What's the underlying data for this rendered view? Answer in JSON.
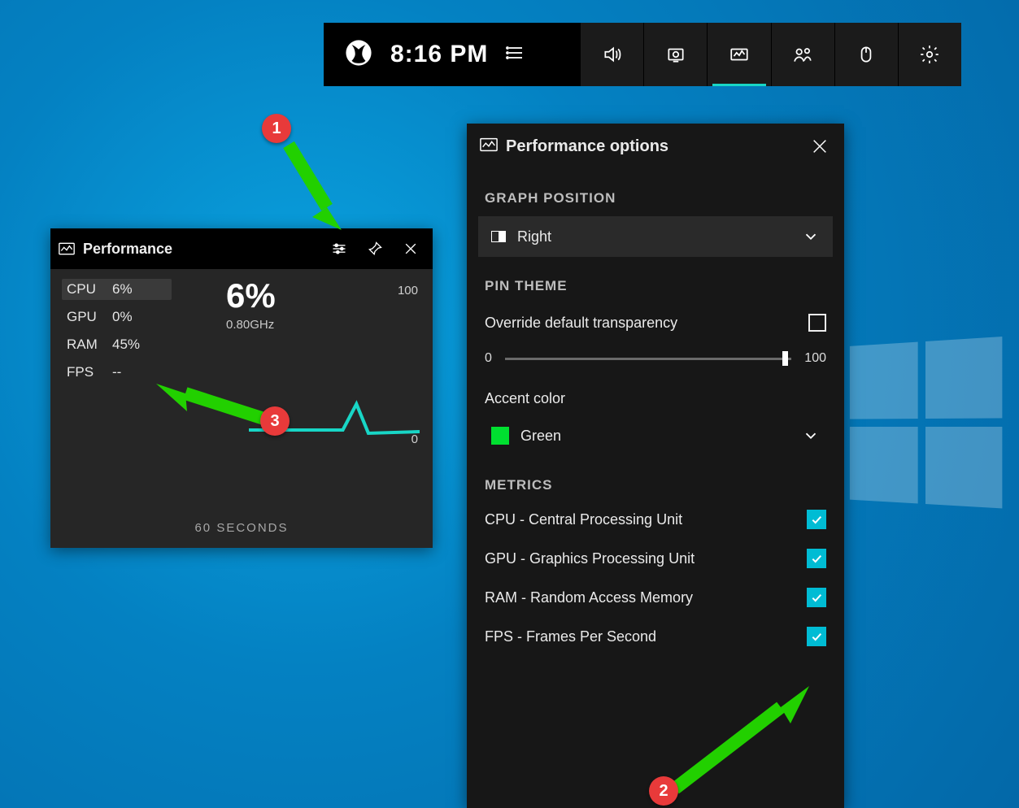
{
  "gamebar": {
    "time": "8:16 PM"
  },
  "performance_widget": {
    "title": "Performance",
    "metrics": [
      {
        "label": "CPU",
        "value": "6%"
      },
      {
        "label": "GPU",
        "value": "0%"
      },
      {
        "label": "RAM",
        "value": "45%"
      },
      {
        "label": "FPS",
        "value": "--"
      }
    ],
    "selected_index": 0,
    "big_value": "6%",
    "clock": "0.80GHz",
    "graph": {
      "ymax": "100",
      "ymin": "0",
      "xaxis": "60 SECONDS"
    }
  },
  "options": {
    "title": "Performance options",
    "graph_position": {
      "label": "GRAPH POSITION",
      "value": "Right"
    },
    "pin_theme": {
      "label": "PIN THEME",
      "override_label": "Override default transparency",
      "override_checked": false,
      "slider": {
        "min": "0",
        "max": "100",
        "value": 95
      }
    },
    "accent": {
      "label": "Accent color",
      "value": "Green",
      "swatch": "#00e030"
    },
    "metrics_label": "METRICS",
    "metrics": [
      {
        "label": "CPU - Central Processing Unit",
        "checked": true
      },
      {
        "label": "GPU - Graphics Processing Unit",
        "checked": true
      },
      {
        "label": "RAM - Random Access Memory",
        "checked": true
      },
      {
        "label": "FPS - Frames Per Second",
        "checked": true
      }
    ]
  },
  "annotations": {
    "b1": "1",
    "b2": "2",
    "b3": "3"
  }
}
